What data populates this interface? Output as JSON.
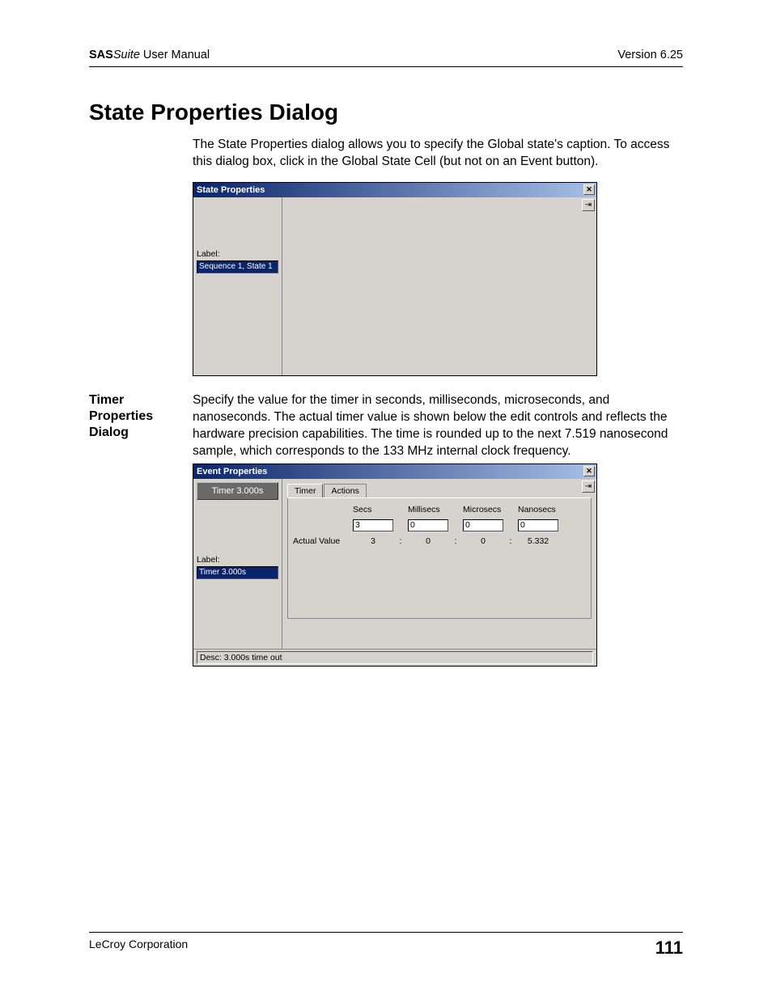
{
  "header": {
    "product_bold": "SAS",
    "product_ital": "Suite",
    "product_tail": " User Manual",
    "version": "Version 6.25"
  },
  "section": {
    "title": "State Properties Dialog",
    "intro": "The State Properties dialog allows you to specify the Global state's caption. To access this dialog box, click in the Global State Cell (but not on an Event button)."
  },
  "dialog1": {
    "title": "State Properties",
    "close_glyph": "✕",
    "pin_glyph": "⇥",
    "label_text": "Label:",
    "label_value": "Sequence 1, State 1"
  },
  "subsection": {
    "heading": "Timer Properties Dialog",
    "body": "Specify the value for the timer in seconds, milliseconds, microseconds, and nanoseconds.  The actual timer value is shown below the edit controls and reflects the hardware precision capabilities.  The time is rounded up to the next 7.519 nanosecond sample, which corresponds to the 133 MHz internal clock frequency."
  },
  "dialog2": {
    "title": "Event Properties",
    "close_glyph": "✕",
    "pin_glyph": "⇥",
    "item_button": "Timer 3.000s",
    "label_text": "Label:",
    "label_value": "Timer 3.000s",
    "tabs": {
      "timer": "Timer",
      "actions": "Actions"
    },
    "cols": {
      "secs": "Secs",
      "millisecs": "Millisecs",
      "microsecs": "Microsecs",
      "nanosecs": "Nanosecs"
    },
    "inputs": {
      "secs": "3",
      "millisecs": "0",
      "microsecs": "0",
      "nanosecs": "0"
    },
    "actual_label": "Actual Value",
    "actual": {
      "secs": "3",
      "millisecs": "0",
      "microsecs": "0",
      "nanosecs": "5.332"
    },
    "colon": ":",
    "status": "Desc: 3.000s time out"
  },
  "footer": {
    "company": "LeCroy Corporation",
    "page": "111"
  }
}
